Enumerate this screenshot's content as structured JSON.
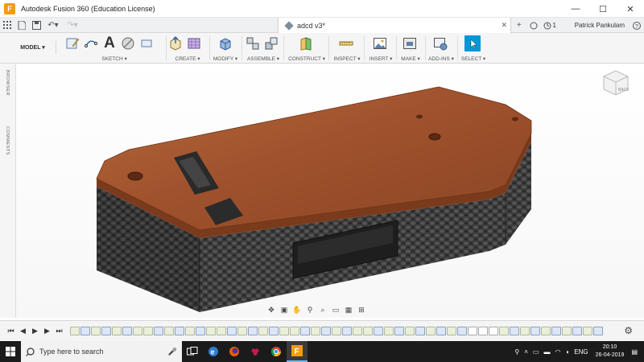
{
  "window": {
    "title": "Autodesk Fusion 360 (Education License)",
    "minimize": "—",
    "maximize": "☐",
    "close": "✕"
  },
  "tabbar": {
    "doc_name": "adcd v3*",
    "doc_close": "✕",
    "add": "+",
    "notif_count": "1",
    "user": "Patrick Pankulam"
  },
  "toolbar": {
    "workspace": "MODEL ▾",
    "groups": [
      {
        "label": "SKETCH ▾"
      },
      {
        "label": "CREATE ▾"
      },
      {
        "label": "MODIFY ▾"
      },
      {
        "label": "ASSEMBLE ▾"
      },
      {
        "label": "CONSTRUCT ▾"
      },
      {
        "label": "INSPECT ▾"
      },
      {
        "label": "INSERT ▾"
      },
      {
        "label": "MAKE ▾"
      },
      {
        "label": "ADD-INS ▾"
      },
      {
        "label": "SELECT ▾"
      }
    ],
    "sketch_text_icon": "A"
  },
  "leftpanel": {
    "browser": "BROWSER",
    "comments": "COMMENTS"
  },
  "viewcube": {
    "back_label": "BACK"
  },
  "taskbar": {
    "search_placeholder": "Type here to search",
    "language": "ENG",
    "time": "20:10",
    "date": "26-04-2019"
  },
  "colors": {
    "top_face": "#a0522d",
    "side_face": "#3a3a3a",
    "accent": "#0696d7",
    "taskbar": "#1b1b1b"
  }
}
